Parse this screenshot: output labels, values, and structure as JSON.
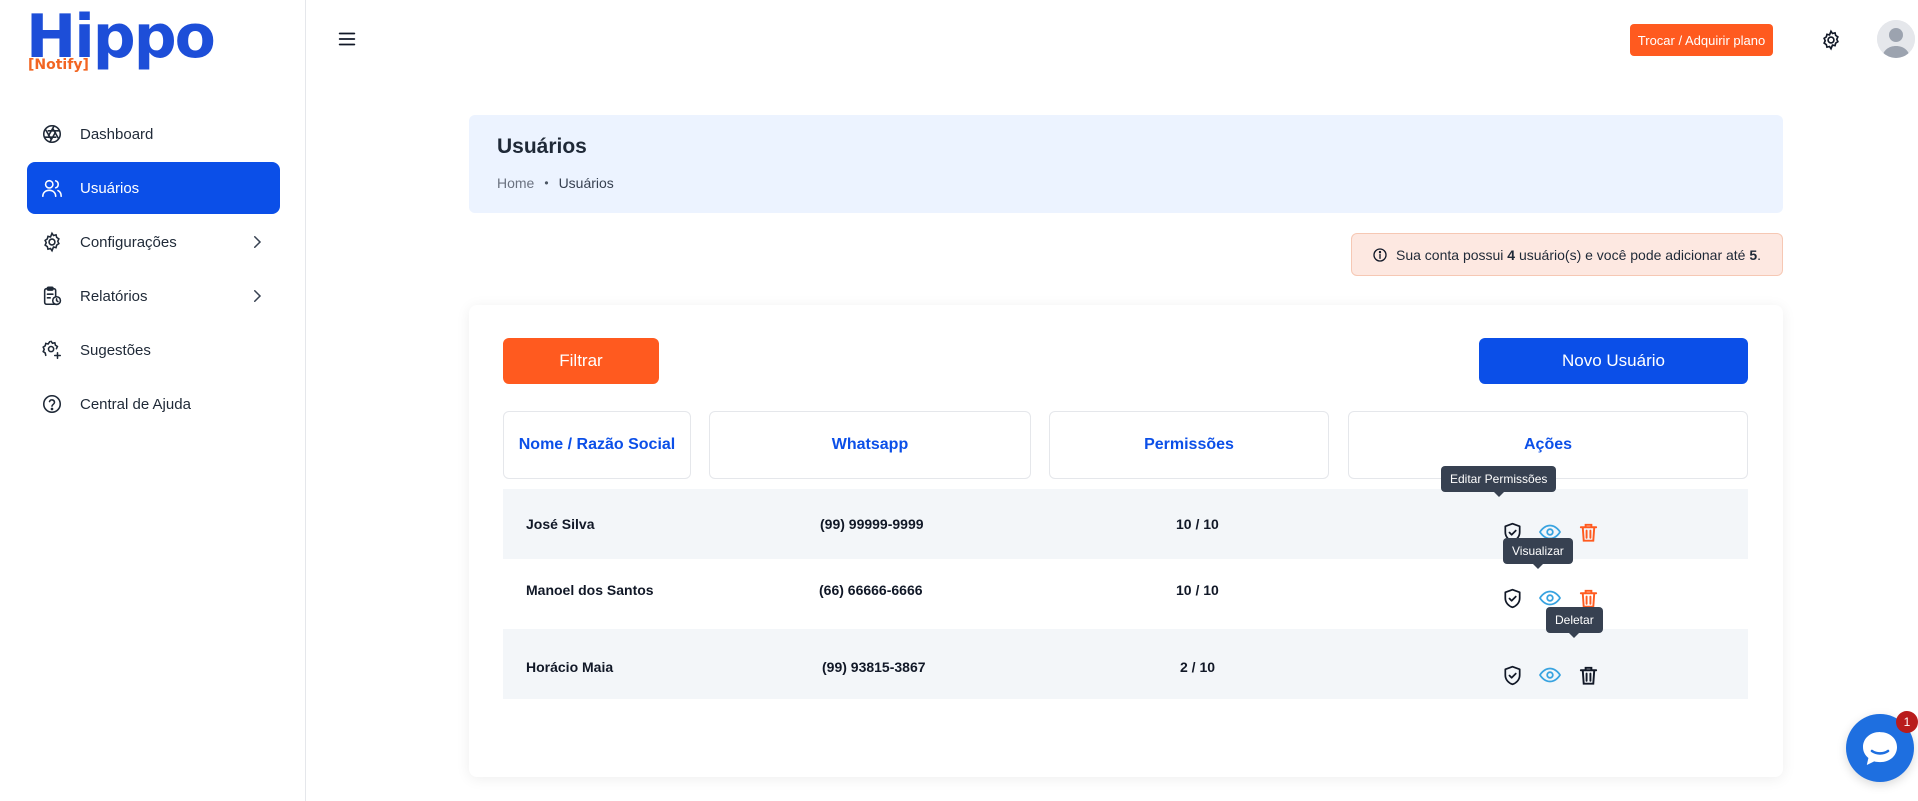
{
  "logo": {
    "word": "Hippo",
    "sub": "[Notify]"
  },
  "sidebar": {
    "items": [
      {
        "label": "Dashboard",
        "icon": "aperture-icon",
        "active": false,
        "has_submenu": false
      },
      {
        "label": "Usuários",
        "icon": "users-icon",
        "active": true,
        "has_submenu": false
      },
      {
        "label": "Configurações",
        "icon": "gear-icon",
        "active": false,
        "has_submenu": true
      },
      {
        "label": "Relatórios",
        "icon": "clipboard-clock-icon",
        "active": false,
        "has_submenu": true
      },
      {
        "label": "Sugestões",
        "icon": "gear-plus-icon",
        "active": false,
        "has_submenu": false
      },
      {
        "label": "Central de Ajuda",
        "icon": "help-circle-icon",
        "active": false,
        "has_submenu": false
      }
    ]
  },
  "topbar": {
    "plan_button": "Trocar / Adquirir plano",
    "settings_icon": "gear-icon",
    "avatar_icon": "user-avatar-icon"
  },
  "header": {
    "title": "Usuários",
    "breadcrumb": {
      "home": "Home",
      "separator": "•",
      "current": "Usuários"
    }
  },
  "alert": {
    "text_before": "Sua conta possui ",
    "count": "4",
    "text_middle": " usuário(s) e você pode adicionar até ",
    "limit": "5",
    "text_after": "."
  },
  "toolbar": {
    "filter_label": "Filtrar",
    "new_user_label": "Novo Usuário"
  },
  "table": {
    "headers": {
      "name": "Nome / Razão Social",
      "whatsapp": "Whatsapp",
      "permissions": "Permissões",
      "actions": "Ações"
    },
    "rows": [
      {
        "name": "José Silva",
        "whatsapp": "(99) 99999-9999",
        "permissions": "10 / 10"
      },
      {
        "name": "Manoel dos Santos",
        "whatsapp": "(66) 66666-6666",
        "permissions": "10 / 10"
      },
      {
        "name": "Horácio Maia",
        "whatsapp": "(99) 93815-3867",
        "permissions": "2 / 10"
      }
    ]
  },
  "tooltips": {
    "edit_permissions": "Editar Permissões",
    "view": "Visualizar",
    "delete": "Deletar"
  },
  "chat": {
    "badge": "1"
  },
  "colors": {
    "primary": "#0b4fe8",
    "accent": "#ff5a1f",
    "header_bg": "#ecf3ff",
    "alert_bg": "#fde8e1",
    "view_icon": "#38a3e0",
    "tooltip_bg": "#374151"
  }
}
